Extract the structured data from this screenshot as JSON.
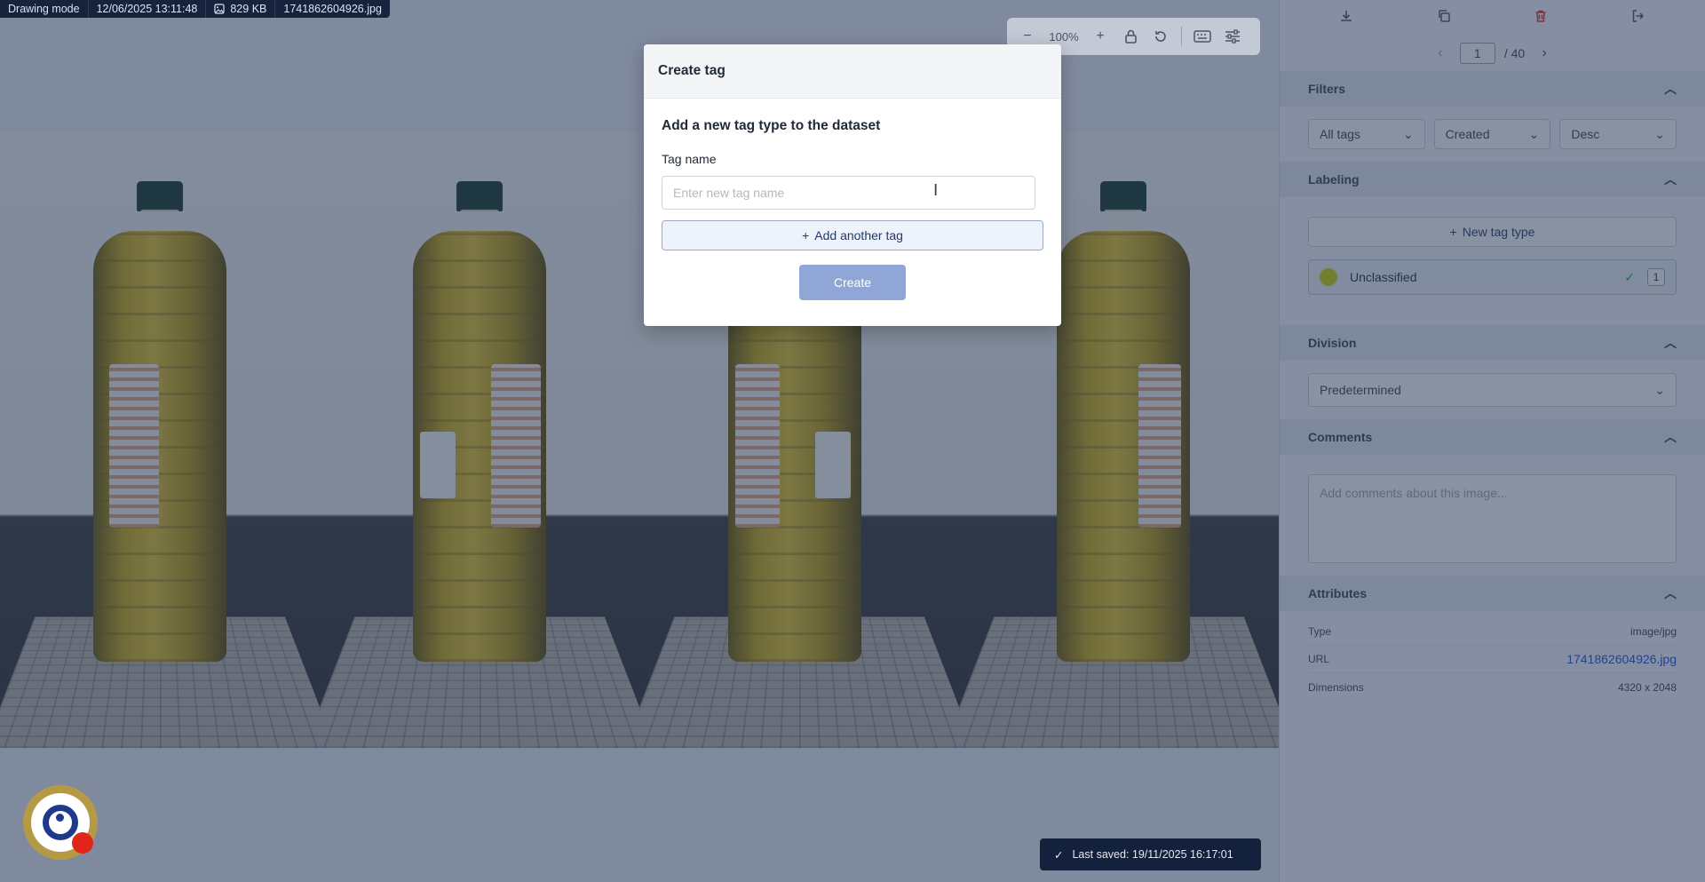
{
  "infobar": {
    "mode": "Drawing mode",
    "datetime": "12/06/2025 13:11:48",
    "filesize": "829 KB",
    "filename": "1741862604926.jpg"
  },
  "toolbar": {
    "zoom_out_icon": "minus-icon",
    "zoom_level": "100%",
    "zoom_in_icon": "plus-icon",
    "lock_icon": "lock-icon",
    "reset_icon": "rotate-ccw-icon",
    "keyboard_icon": "keyboard-icon",
    "settings_icon": "sliders-icon"
  },
  "sidebar": {
    "actions": [
      "download-icon",
      "copy-icon",
      "trash-icon",
      "logout-icon"
    ],
    "pager": {
      "current": "1",
      "total": "/ 40"
    },
    "filters": {
      "title": "Filters",
      "selects": [
        "All tags",
        "Created",
        "Desc"
      ]
    },
    "labeling": {
      "title": "Labeling",
      "new_tag_label": "New tag type",
      "tags": [
        {
          "name": "Unclassified",
          "color": "#cfd400",
          "count": "1"
        }
      ]
    },
    "division": {
      "title": "Division",
      "value": "Predetermined"
    },
    "comments": {
      "title": "Comments",
      "placeholder": "Add comments about this image..."
    },
    "attributes": {
      "title": "Attributes",
      "rows": [
        {
          "key": "Type",
          "value": "image/jpg"
        },
        {
          "key": "URL",
          "value": "1741862604926.jpg"
        },
        {
          "key": "Dimensions",
          "value": "4320 x 2048"
        }
      ]
    }
  },
  "status": {
    "saved": "Last saved: 19/11/2025 16:17:01"
  },
  "modal": {
    "title": "Create tag",
    "subtitle": "Add a new tag type to the dataset",
    "field_label": "Tag name",
    "field_placeholder": "Enter new tag name",
    "field_value": "",
    "add_another": "Add another tag",
    "create_label": "Create"
  },
  "colors": {
    "accent": "#1f3a68",
    "create_button": "#8fa6d6",
    "delete": "#d93025",
    "success": "#1aa55a"
  }
}
